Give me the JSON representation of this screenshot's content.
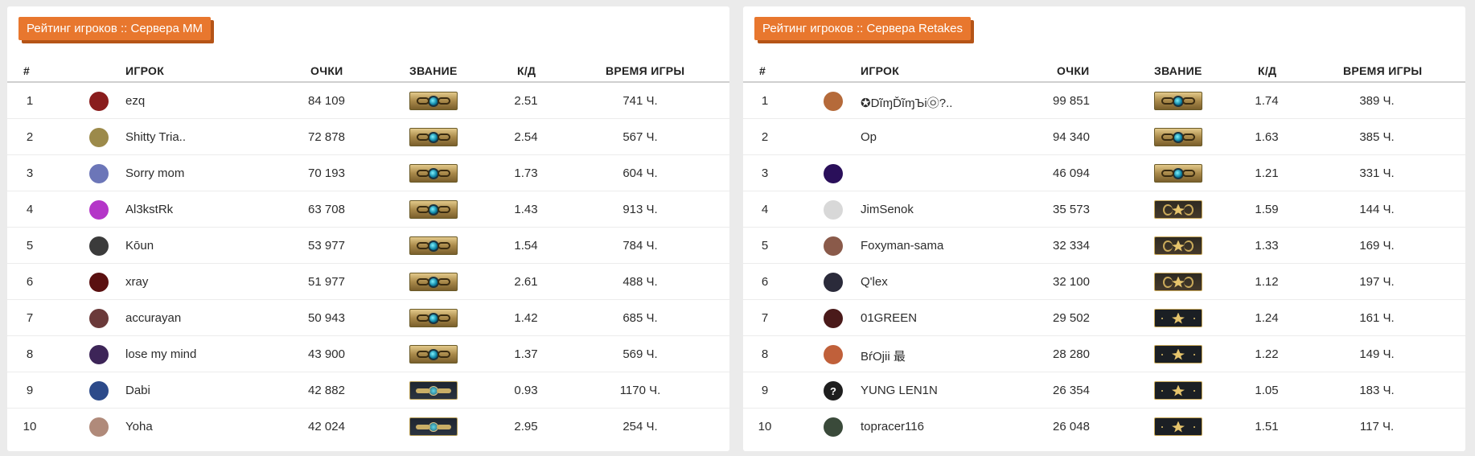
{
  "panels": [
    {
      "title": "Рейтинг игроков :: Сервера ММ",
      "headers": {
        "rank": "#",
        "player": "ИГРОК",
        "points": "ОЧКИ",
        "title": "ЗВАНИЕ",
        "kd": "К/Д",
        "time": "ВРЕМЯ ИГРЫ"
      },
      "rows": [
        {
          "rank": "1",
          "name": "ezq",
          "points": "84 109",
          "kd": "2.51",
          "time": "741 Ч.",
          "avatar_color": "#8a1d1d",
          "rank_icon": "gold"
        },
        {
          "rank": "2",
          "name": "Shitty Tria..",
          "points": "72 878",
          "kd": "2.54",
          "time": "567 Ч.",
          "avatar_color": "#9c8a4a",
          "rank_icon": "gold"
        },
        {
          "rank": "3",
          "name": "Sorry mom",
          "points": "70 193",
          "kd": "1.73",
          "time": "604 Ч.",
          "avatar_color": "#6c76b8",
          "rank_icon": "gold"
        },
        {
          "rank": "4",
          "name": "Al3kstRk",
          "points": "63 708",
          "kd": "1.43",
          "time": "913 Ч.",
          "avatar_color": "#b436c8",
          "rank_icon": "gold"
        },
        {
          "rank": "5",
          "name": "Kōun",
          "points": "53 977",
          "kd": "1.54",
          "time": "784 Ч.",
          "avatar_color": "#3b3b3b",
          "rank_icon": "gold"
        },
        {
          "rank": "6",
          "name": "xray",
          "points": "51 977",
          "kd": "2.61",
          "time": "488 Ч.",
          "avatar_color": "#5a1010",
          "rank_icon": "gold"
        },
        {
          "rank": "7",
          "name": "accurayan",
          "points": "50 943",
          "kd": "1.42",
          "time": "685 Ч.",
          "avatar_color": "#6b3a3a",
          "rank_icon": "gold"
        },
        {
          "rank": "8",
          "name": "lose my mind",
          "points": "43 900",
          "kd": "1.37",
          "time": "569 Ч.",
          "avatar_color": "#3d2558",
          "rank_icon": "gold"
        },
        {
          "rank": "9",
          "name": "Dabi",
          "points": "42 882",
          "kd": "0.93",
          "time": "1170 Ч.",
          "avatar_color": "#2c4a8a",
          "rank_icon": "badge"
        },
        {
          "rank": "10",
          "name": "Yoha",
          "points": "42 024",
          "kd": "2.95",
          "time": "254 Ч.",
          "avatar_color": "#b08a7a",
          "rank_icon": "badge"
        }
      ]
    },
    {
      "title": "Рейтинг игроков :: Сервера Retakes",
      "headers": {
        "rank": "#",
        "player": "ИГРОК",
        "points": "ОЧКИ",
        "title": "ЗВАНИЕ",
        "kd": "К/Д",
        "time": "ВРЕМЯ ИГРЫ"
      },
      "rows": [
        {
          "rank": "1",
          "name": "✪DĩɱĎĩɱЪi㉧?..",
          "points": "99 851",
          "kd": "1.74",
          "time": "389 Ч.",
          "avatar_color": "#b56a3a",
          "rank_icon": "gold"
        },
        {
          "rank": "2",
          "name": "Op",
          "points": "94 340",
          "kd": "1.63",
          "time": "385 Ч.",
          "avatar_color": "#ffffff",
          "rank_icon": "gold"
        },
        {
          "rank": "3",
          "name": "",
          "points": "46 094",
          "kd": "1.21",
          "time": "331 Ч.",
          "avatar_color": "#2a0f5a",
          "rank_icon": "gold"
        },
        {
          "rank": "4",
          "name": "JimSenok",
          "points": "35 573",
          "kd": "1.59",
          "time": "144 Ч.",
          "avatar_color": "#d8d8d8",
          "rank_icon": "eagle"
        },
        {
          "rank": "5",
          "name": "Foxyman-sama",
          "points": "32 334",
          "kd": "1.33",
          "time": "169 Ч.",
          "avatar_color": "#8a5a4a",
          "rank_icon": "eagle"
        },
        {
          "rank": "6",
          "name": "Q'lex",
          "points": "32 100",
          "kd": "1.12",
          "time": "197 Ч.",
          "avatar_color": "#2a2a3a",
          "rank_icon": "eagle"
        },
        {
          "rank": "7",
          "name": "01GREEN",
          "points": "29 502",
          "kd": "1.24",
          "time": "161 Ч.",
          "avatar_color": "#4a1a1a",
          "rank_icon": "plain"
        },
        {
          "rank": "8",
          "name": "BŕOjii 最",
          "points": "28 280",
          "kd": "1.22",
          "time": "149 Ч.",
          "avatar_color": "#c0603a",
          "rank_icon": "plain"
        },
        {
          "rank": "9",
          "name": "YUNG LEN1N",
          "points": "26 354",
          "kd": "1.05",
          "time": "183 Ч.",
          "avatar_color": "#1e1e1e",
          "avatar_glyph": "?",
          "rank_icon": "plain"
        },
        {
          "rank": "10",
          "name": "topracer116",
          "points": "26 048",
          "kd": "1.51",
          "time": "117 Ч.",
          "avatar_color": "#3a4a3a",
          "rank_icon": "plain"
        }
      ]
    }
  ]
}
